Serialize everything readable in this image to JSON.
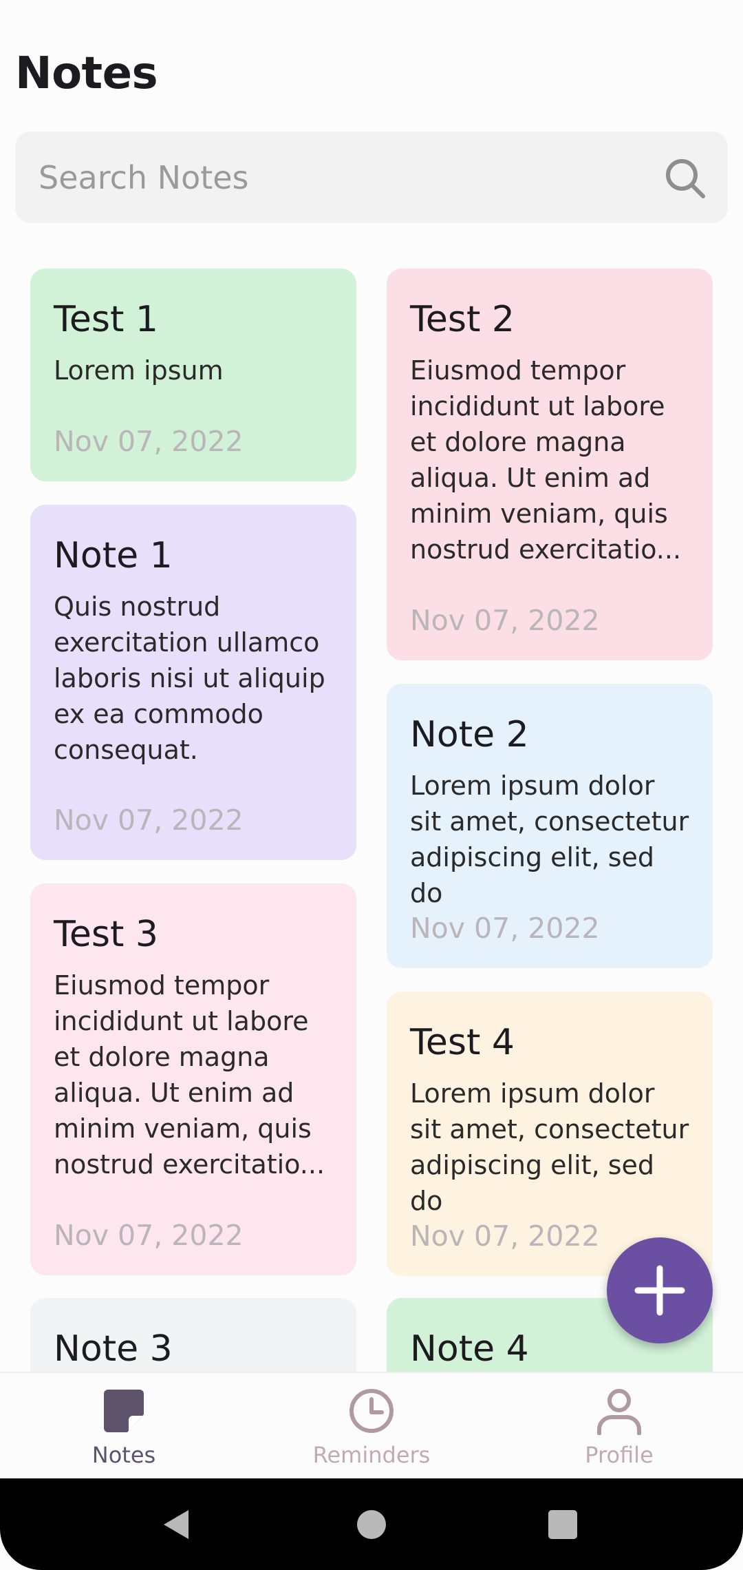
{
  "header": {
    "title": "Notes"
  },
  "search": {
    "placeholder": "Search Notes",
    "value": ""
  },
  "notes": [
    {
      "title": "Test 1",
      "body": "Lorem ipsum",
      "date": "Nov 07, 2022",
      "color": "#d2f2d8"
    },
    {
      "title": "Test 2",
      "body": "Eiusmod tempor incididunt ut labore et dolore magna aliqua. Ut enim ad minim veniam, quis nostrud exercitatio...",
      "date": "Nov 07, 2022",
      "color": "#fcdee7"
    },
    {
      "title": "Note 1",
      "body": "Quis nostrud exercitation ullamco laboris nisi ut aliquip ex ea commodo consequat.",
      "date": "Nov 07, 2022",
      "color": "#e6e0fb"
    },
    {
      "title": "Note 2",
      "body": "Lorem ipsum dolor sit amet, consectetur adipiscing elit, sed do",
      "date": "Nov 07, 2022",
      "color": "#e5f2fb"
    },
    {
      "title": "Test 3",
      "body": "Eiusmod tempor incididunt ut labore et dolore magna aliqua. Ut enim ad minim veniam, quis nostrud exercitatio...",
      "date": "Nov 07, 2022",
      "color": "#fde6ee"
    },
    {
      "title": "Test 4",
      "body": "Lorem ipsum dolor sit amet, consectetur adipiscing elit, sed do",
      "date": "Nov 07, 2022",
      "color": "#fdf3e0"
    },
    {
      "title": "Note 3",
      "color": "#f2f3f5"
    },
    {
      "title": "Note 4",
      "color": "#d2f2d8"
    }
  ],
  "fab": {
    "icon": "plus-icon",
    "color": "#6a4fa3"
  },
  "bottom_nav": {
    "items": [
      {
        "label": "Notes",
        "icon": "note-icon",
        "active": true
      },
      {
        "label": "Reminders",
        "icon": "clock-icon",
        "active": false
      },
      {
        "label": "Profile",
        "icon": "person-icon",
        "active": false
      }
    ]
  },
  "system_nav": {
    "buttons": [
      "back-icon",
      "home-icon",
      "recents-icon"
    ]
  }
}
